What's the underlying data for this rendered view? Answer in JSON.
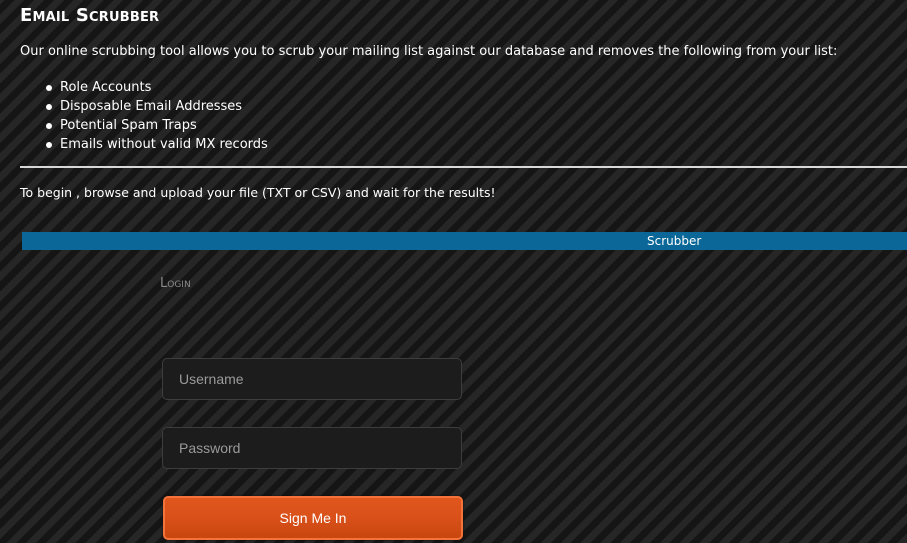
{
  "header": {
    "title": "Email Scrubber"
  },
  "intro": {
    "text": "Our online scrubbing tool allows you to scrub your mailing list against our database and removes the following from your list:"
  },
  "features": [
    "Role Accounts",
    "Disposable Email Addresses",
    "Potential Spam Traps",
    "Emails without valid MX records"
  ],
  "instructions": {
    "text": "To begin , browse and upload your file (TXT or CSV) and wait for the results!"
  },
  "bar": {
    "label": "Scrubber"
  },
  "login": {
    "heading": "Login",
    "username_placeholder": "Username",
    "password_placeholder": "Password",
    "submit_label": "Sign Me In"
  },
  "colors": {
    "bar": "#0a6798",
    "button": "#d9501a",
    "button_border": "#f3733a",
    "divider": "#d8d8d8"
  }
}
